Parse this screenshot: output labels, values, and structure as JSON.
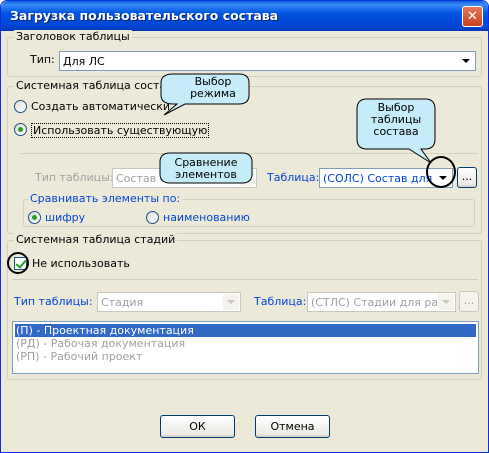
{
  "window": {
    "title": "Загрузка пользовательского состава",
    "close_icon": "close-icon"
  },
  "header_group": {
    "legend": "Заголовок таблицы",
    "type_label": "Тип:",
    "type_value": "Для ЛС"
  },
  "system_group": {
    "legend": "Системная таблица состава",
    "radio_auto": "Создать автоматически",
    "radio_existing": "Использовать существующую",
    "table_type_label": "Тип таблицы:",
    "table_type_value": "Состав",
    "table_label": "Таблица:",
    "table_value": "(СОЛС) Состав для ра",
    "browse_label": "...",
    "compare_legend": "Сравнивать элементы по:",
    "compare_cipher": "шифру",
    "compare_name": "наименованию"
  },
  "stage_group": {
    "legend": "Системная таблица стадий",
    "checkbox_label": "Не использовать",
    "table_type_label": "Тип таблицы:",
    "table_type_value": "Стадия",
    "table_label": "Таблица:",
    "table_value": "(СТЛС) Стадии для разб",
    "browse_label": "...",
    "items": [
      "(П) - Проектная документация",
      "(РД) - Рабочая документация",
      "(РП) - Рабочий проект"
    ]
  },
  "callouts": {
    "mode": "Выбор режима",
    "compare": "Сравнение элементов",
    "table": "Выбор таблицы состава"
  },
  "footer": {
    "ok_label": "ОК",
    "cancel_label": "Отмена"
  },
  "colors": {
    "title_bar": "#0054e3",
    "selection": "#316ac5",
    "group_label_blue": "#0046d5",
    "callout_fill": "#c5ecf9"
  }
}
